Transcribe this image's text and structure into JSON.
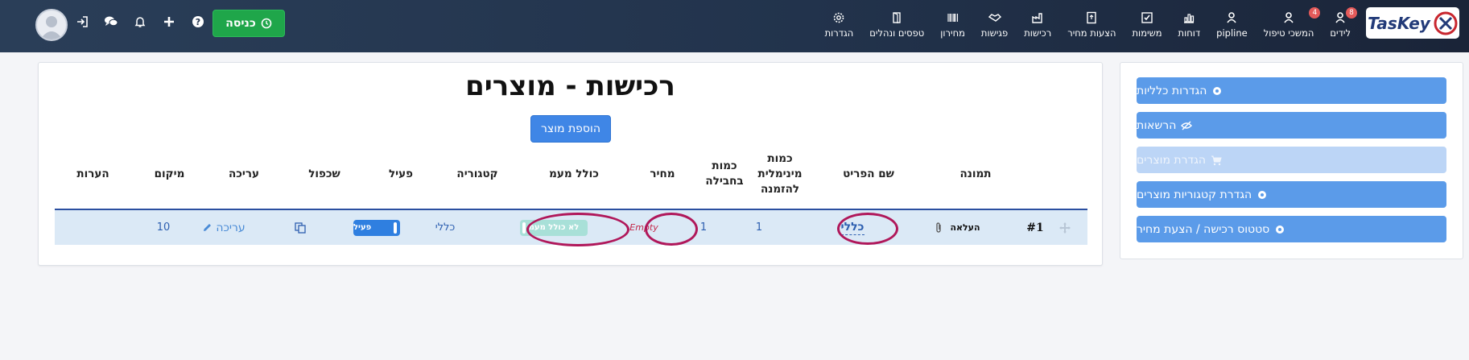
{
  "brand": {
    "name": "TasKey"
  },
  "nav": [
    {
      "label": "לידים",
      "icon": "user-group-icon",
      "badge": "8"
    },
    {
      "label": "המשכי טיפול",
      "icon": "user-group-icon",
      "badge": "4"
    },
    {
      "label": "pipline",
      "icon": "user-group-icon"
    },
    {
      "label": "דוחות",
      "icon": "bar-chart-icon"
    },
    {
      "label": "משימות",
      "icon": "checkbox-icon"
    },
    {
      "label": "הצעות מחיר",
      "icon": "document-icon"
    },
    {
      "label": "רכישות",
      "icon": "factory-icon"
    },
    {
      "label": "פגישות",
      "icon": "handshake-icon"
    },
    {
      "label": "מחירון",
      "icon": "barcode-icon"
    },
    {
      "label": "טפסים ונהלים",
      "icon": "door-icon"
    },
    {
      "label": "הגדרות",
      "icon": "gear-icon"
    }
  ],
  "entry_button": {
    "label": "כניסה",
    "icon": "clock-icon"
  },
  "toolbar_icons": [
    "help-icon",
    "plus-icon",
    "bell-icon",
    "chat-icon",
    "sign-in-icon"
  ],
  "sidebar": [
    {
      "label": "הגדרות כלליות",
      "icon": "gear-icon",
      "disabled": false
    },
    {
      "label": "הרשאות",
      "icon": "eye-slash-icon",
      "disabled": false
    },
    {
      "label": "הגדרת מוצרים",
      "icon": "cart-icon",
      "disabled": true
    },
    {
      "label": "הגדרת קטגוריות מוצרים",
      "icon": "gear-icon",
      "disabled": false
    },
    {
      "label": "סטטוס רכישה / הצעת מחיר",
      "icon": "gear-icon",
      "disabled": false
    }
  ],
  "main": {
    "title": "רכישות - מוצרים",
    "add_button": "הוספת מוצר",
    "columns": {
      "image": "תמונה",
      "name": "שם הפריט",
      "min_qty_line1": "כמות",
      "min_qty_line2": "מינימלית",
      "min_qty_line3": "להזמנה",
      "pack_qty_line1": "כמות",
      "pack_qty_line2": "בחבילה",
      "price": "מחיר",
      "vat": "כולל מעמ",
      "category": "קטגוריה",
      "active": "פעיל",
      "duplicate": "שכפול",
      "edit": "עריכה",
      "position": "מיקום",
      "notes": "הערות"
    },
    "row": {
      "index": "#1",
      "upload": "העלאה",
      "name": "כללי",
      "min_qty": "1",
      "pack_qty": "1",
      "price": "Empty",
      "vat": "לא כולל מעמ",
      "category": "כללי",
      "active": "פעיל",
      "edit": "עריכה",
      "position": "10",
      "notes": ""
    }
  },
  "colors": {
    "nav_bg": "#22334c",
    "sidebar_button": "#5b9be9",
    "sidebar_button_disabled": "#bcd5f6",
    "highlight": "#b0175a",
    "row_bg": "#dbe9f6",
    "entry_button": "#1fa64a"
  }
}
